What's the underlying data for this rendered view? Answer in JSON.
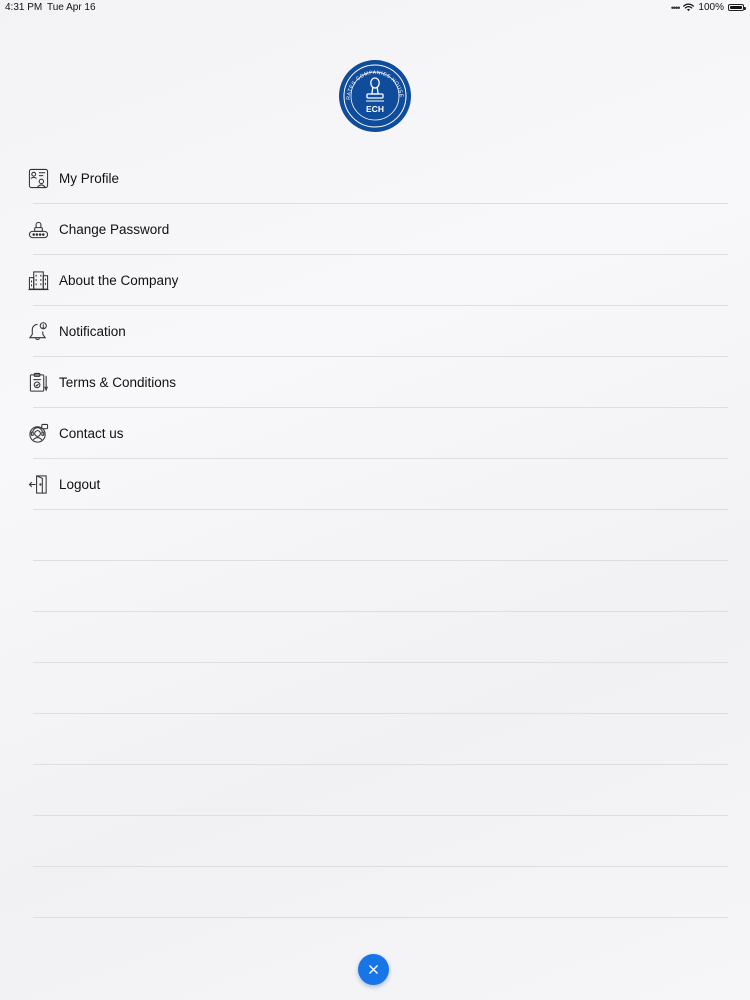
{
  "status_bar": {
    "time": "4:31 PM",
    "date": "Tue Apr 16",
    "battery": "100%",
    "battery_level": 1.0
  },
  "logo": {
    "ring_text": "EMIRATES COMPANIES HOUSE LLC",
    "initials": "ECH",
    "color": "#0f4c9c",
    "icon": "stamp-logo"
  },
  "menu": {
    "items": [
      {
        "label": "My Profile",
        "icon": "profile-icon"
      },
      {
        "label": "Change Password",
        "icon": "password-icon"
      },
      {
        "label": "About the Company",
        "icon": "building-icon"
      },
      {
        "label": "Notification",
        "icon": "bell-icon"
      },
      {
        "label": "Terms & Conditions",
        "icon": "document-icon"
      },
      {
        "label": "Contact us",
        "icon": "support-icon"
      },
      {
        "label": "Logout",
        "icon": "logout-icon"
      }
    ],
    "empty_rows": 8
  },
  "close_button": {
    "icon": "close-icon",
    "color": "#1875e8"
  }
}
